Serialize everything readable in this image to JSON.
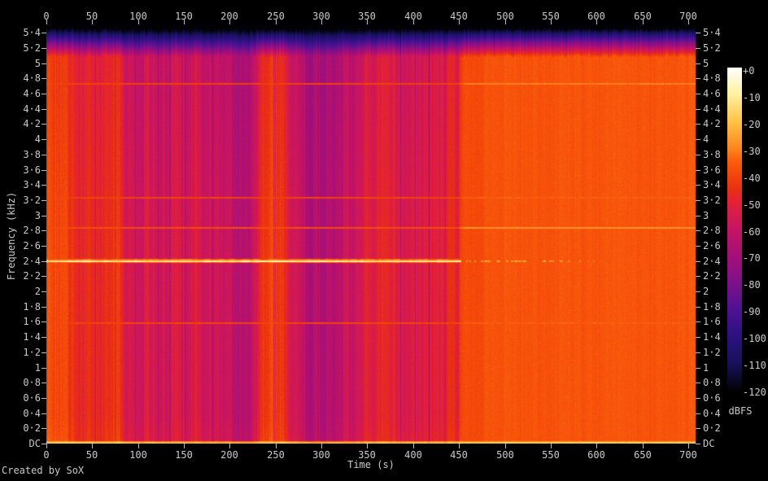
{
  "credit": "Created by SoX",
  "colors": {
    "background": "#000000",
    "tick": "#b9b9b9",
    "label": "#c9c9c9"
  },
  "axes": {
    "time": {
      "title": "Time (s)",
      "ticks": [
        {
          "label": "0",
          "s": 0
        },
        {
          "label": "50",
          "s": 50
        },
        {
          "label": "100",
          "s": 100
        },
        {
          "label": "150",
          "s": 150
        },
        {
          "label": "200",
          "s": 200
        },
        {
          "label": "250",
          "s": 250
        },
        {
          "label": "300",
          "s": 300
        },
        {
          "label": "350",
          "s": 350
        },
        {
          "label": "400",
          "s": 400
        },
        {
          "label": "450",
          "s": 450
        },
        {
          "label": "500",
          "s": 500
        },
        {
          "label": "550",
          "s": 550
        },
        {
          "label": "600",
          "s": 600
        },
        {
          "label": "650",
          "s": 650
        },
        {
          "label": "700",
          "s": 700
        }
      ]
    },
    "freq": {
      "title": "Frequency (kHz)",
      "ticks": [
        {
          "label": "DC",
          "khz": 0
        },
        {
          "label": "0·2",
          "khz": 0.2
        },
        {
          "label": "0·4",
          "khz": 0.4
        },
        {
          "label": "0·6",
          "khz": 0.6
        },
        {
          "label": "0·8",
          "khz": 0.8
        },
        {
          "label": "1",
          "khz": 1
        },
        {
          "label": "1·2",
          "khz": 1.2
        },
        {
          "label": "1·4",
          "khz": 1.4
        },
        {
          "label": "1·6",
          "khz": 1.6
        },
        {
          "label": "1·8",
          "khz": 1.8
        },
        {
          "label": "2",
          "khz": 2
        },
        {
          "label": "2·2",
          "khz": 2.2
        },
        {
          "label": "2·4",
          "khz": 2.4
        },
        {
          "label": "2·6",
          "khz": 2.6
        },
        {
          "label": "2·8",
          "khz": 2.8
        },
        {
          "label": "3",
          "khz": 3
        },
        {
          "label": "3·2",
          "khz": 3.2
        },
        {
          "label": "3·4",
          "khz": 3.4
        },
        {
          "label": "3·6",
          "khz": 3.6
        },
        {
          "label": "3·8",
          "khz": 3.8
        },
        {
          "label": "4",
          "khz": 4
        },
        {
          "label": "4·2",
          "khz": 4.2
        },
        {
          "label": "4·4",
          "khz": 4.4
        },
        {
          "label": "4·6",
          "khz": 4.6
        },
        {
          "label": "4·8",
          "khz": 4.8
        },
        {
          "label": "5",
          "khz": 5
        },
        {
          "label": "5·2",
          "khz": 5.2
        },
        {
          "label": "5·4",
          "khz": 5.4
        }
      ]
    },
    "level": {
      "title": "dBFS",
      "ticks": [
        {
          "label": "+0",
          "db": 0
        },
        {
          "label": "-10",
          "db": -10
        },
        {
          "label": "-20",
          "db": -20
        },
        {
          "label": "-30",
          "db": -30
        },
        {
          "label": "-40",
          "db": -40
        },
        {
          "label": "-50",
          "db": -50
        },
        {
          "label": "-60",
          "db": -60
        },
        {
          "label": "-70",
          "db": -70
        },
        {
          "label": "-80",
          "db": -80
        },
        {
          "label": "-90",
          "db": -90
        },
        {
          "label": "-100",
          "db": -100
        },
        {
          "label": "-110",
          "db": -110
        },
        {
          "label": "-120",
          "db": -120
        }
      ]
    }
  },
  "chart_data": {
    "type": "heatmap",
    "subtype": "audio-spectrogram",
    "title": "",
    "xlabel": "Time (s)",
    "ylabel": "Frequency (kHz)",
    "zlabel": "dBFS",
    "x_range_s": [
      0,
      708
    ],
    "y_range_khz": [
      0,
      5.51
    ],
    "z_range_dbfs": [
      -120,
      0
    ],
    "grid": false,
    "legend": "colorbar-right",
    "palette_stops": [
      [
        0.0,
        2,
        2,
        6
      ],
      [
        0.083,
        22,
        17,
        90
      ],
      [
        0.167,
        44,
        17,
        128
      ],
      [
        0.25,
        78,
        17,
        146
      ],
      [
        0.333,
        125,
        16,
        138
      ],
      [
        0.417,
        165,
        15,
        120
      ],
      [
        0.5,
        197,
        20,
        100
      ],
      [
        0.583,
        228,
        33,
        55
      ],
      [
        0.625,
        233,
        48,
        17
      ],
      [
        0.667,
        243,
        70,
        10
      ],
      [
        0.708,
        250,
        92,
        12
      ],
      [
        0.75,
        252,
        134,
        30
      ],
      [
        0.833,
        254,
        195,
        70
      ],
      [
        0.917,
        255,
        240,
        160
      ],
      [
        1.0,
        255,
        255,
        255
      ]
    ],
    "sections": [
      {
        "from_s": 0,
        "to_s": 452,
        "base_dbfs": -44,
        "stripe_noise_db": 3.5,
        "pixel_noise_db": 2.8,
        "hf_tilt_db_per_khz": -1.3
      },
      {
        "from_s": 452,
        "to_s": 708,
        "base_dbfs": -37,
        "stripe_noise_db": 1.2,
        "pixel_noise_db": 2.2,
        "hf_tilt_db_per_khz": 0
      }
    ],
    "section_change_s": 452,
    "dark_bands_s": [
      [
        2,
        4,
        5
      ],
      [
        8,
        6,
        4
      ],
      [
        38,
        5,
        -6
      ],
      [
        45,
        5,
        3
      ],
      [
        58,
        6,
        -7
      ],
      [
        78,
        5,
        4
      ],
      [
        86,
        8,
        -9
      ],
      [
        101,
        5,
        -12
      ],
      [
        118,
        7,
        -10
      ],
      [
        133,
        9,
        -13
      ],
      [
        152,
        6,
        -11
      ],
      [
        165,
        3,
        3
      ],
      [
        172,
        9,
        -15
      ],
      [
        190,
        7,
        -12
      ],
      [
        207,
        10,
        -16
      ],
      [
        222,
        8,
        -13
      ],
      [
        242,
        7,
        5
      ],
      [
        255,
        5,
        4
      ],
      [
        270,
        10,
        -13
      ],
      [
        287,
        8,
        -15
      ],
      [
        303,
        10,
        -16
      ],
      [
        320,
        9,
        -13
      ],
      [
        338,
        8,
        -11
      ],
      [
        350,
        4,
        3
      ],
      [
        356,
        7,
        -9
      ],
      [
        376,
        8,
        -7
      ],
      [
        395,
        9,
        -8
      ],
      [
        414,
        7,
        -8
      ],
      [
        432,
        6,
        -6
      ],
      [
        447,
        4,
        -5
      ]
    ],
    "right_stripe_bands_s": [
      [
        460,
        6,
        -2.5
      ],
      [
        472,
        5,
        -2
      ]
    ],
    "tonal_lines": [
      {
        "khz": 2.4,
        "kind": "strong",
        "level_dbfs": -13,
        "solid_until_s": 452,
        "dashed_until_s": 600,
        "dashed_level_dbfs": -27,
        "bloom_dbfs": -34
      },
      {
        "khz": 2.83,
        "kind": "faint",
        "rel_db_s1": 5.0,
        "rel_db_s2": 9.0
      },
      {
        "khz": 4.73,
        "kind": "faint",
        "rel_db_s1": 2.5,
        "rel_db_s2": 6.0
      },
      {
        "khz": 3.23,
        "kind": "faint",
        "rel_db_s1": 3.0,
        "rel_db_s2": 2.0
      },
      {
        "khz": 1.58,
        "kind": "faint",
        "rel_db_s1": 3.5,
        "rel_db_s2": 2.0
      }
    ],
    "dc_line": {
      "level_dbfs": -17
    },
    "hf_rolloff": {
      "start_khz": 5.08,
      "black_khz": 5.47
    }
  }
}
